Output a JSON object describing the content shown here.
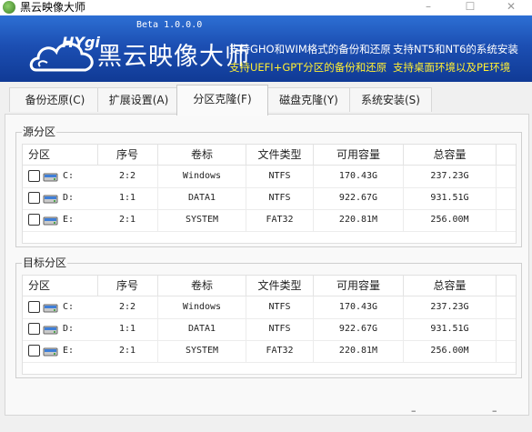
{
  "window": {
    "title": "黑云映像大师",
    "minimize": "–",
    "maximize": "☐",
    "close": "✕"
  },
  "banner": {
    "logo_text": "HYgi",
    "version": "Beta 1.0.0.0",
    "brand": "黑云映像大师",
    "features": [
      "支持GHO和WIM格式的备份和还原",
      "支持NT5和NT6的系统安装",
      "支持UEFI+GPT分区的备份和还原",
      "支持桌面环境以及PE环境"
    ]
  },
  "tabs": [
    "备份还原(C)",
    "扩展设置(A)",
    "分区克隆(F)",
    "磁盘克隆(Y)",
    "系统安装(S)"
  ],
  "active_tab": "分区克隆(F)",
  "columns": [
    "分区",
    "序号",
    "卷标",
    "文件类型",
    "可用容量",
    "总容量"
  ],
  "source": {
    "label": "源分区",
    "rows": [
      {
        "drive": "C:",
        "index": "2:2",
        "volume": "Windows",
        "fs": "NTFS",
        "free": "170.43G",
        "total": "237.23G"
      },
      {
        "drive": "D:",
        "index": "1:1",
        "volume": "DATA1",
        "fs": "NTFS",
        "free": "922.67G",
        "total": "931.51G"
      },
      {
        "drive": "E:",
        "index": "2:1",
        "volume": "SYSTEM",
        "fs": "FAT32",
        "free": "220.81M",
        "total": "256.00M"
      }
    ]
  },
  "target": {
    "label": "目标分区",
    "rows": [
      {
        "drive": "C:",
        "index": "2:2",
        "volume": "Windows",
        "fs": "NTFS",
        "free": "170.43G",
        "total": "237.23G"
      },
      {
        "drive": "D:",
        "index": "1:1",
        "volume": "DATA1",
        "fs": "NTFS",
        "free": "922.67G",
        "total": "931.51G"
      },
      {
        "drive": "E:",
        "index": "2:1",
        "volume": "SYSTEM",
        "fs": "FAT32",
        "free": "220.81M",
        "total": "256.00M"
      }
    ]
  },
  "bottom_marks": [
    "–",
    "–"
  ],
  "colors": {
    "banner_top": "#2d6fd4",
    "banner_bottom": "#103a95",
    "feature_white": "#ffffff",
    "feature_yellow": "#ffee33"
  }
}
